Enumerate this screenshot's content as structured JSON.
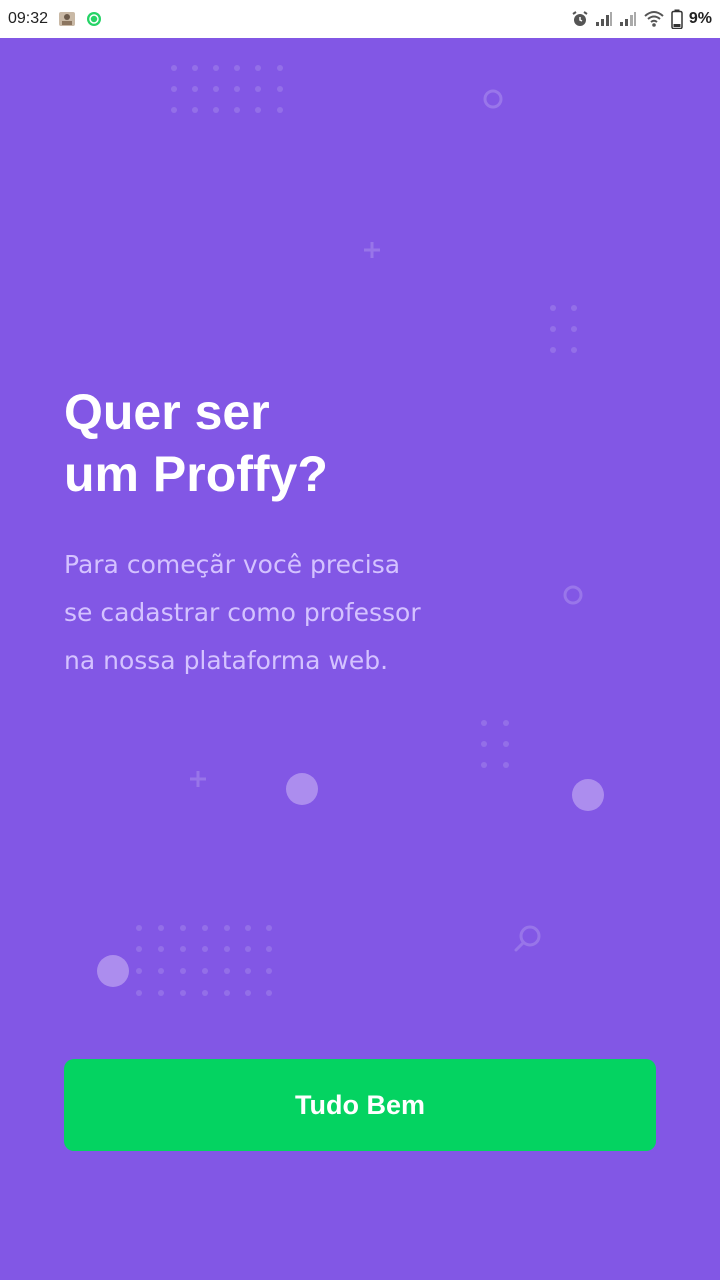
{
  "status_bar": {
    "time": "09:32",
    "battery": "9%",
    "icons": [
      "notification-photo-icon",
      "whatsapp-icon",
      "alarm-icon",
      "signal-icon",
      "signal-icon",
      "wifi-icon",
      "battery-icon"
    ]
  },
  "screen": {
    "title_lines": [
      "Quer ser",
      "um Proffy?"
    ],
    "description_lines": [
      "Para começãr você precisa",
      "se cadastrar como professor",
      "na nossa plataforma web."
    ],
    "button_label": "Tudo Bem"
  },
  "colors": {
    "background": "#8257e5",
    "button": "#04d361",
    "description_text": "#d4c2ff",
    "title_text": "#ffffff"
  }
}
